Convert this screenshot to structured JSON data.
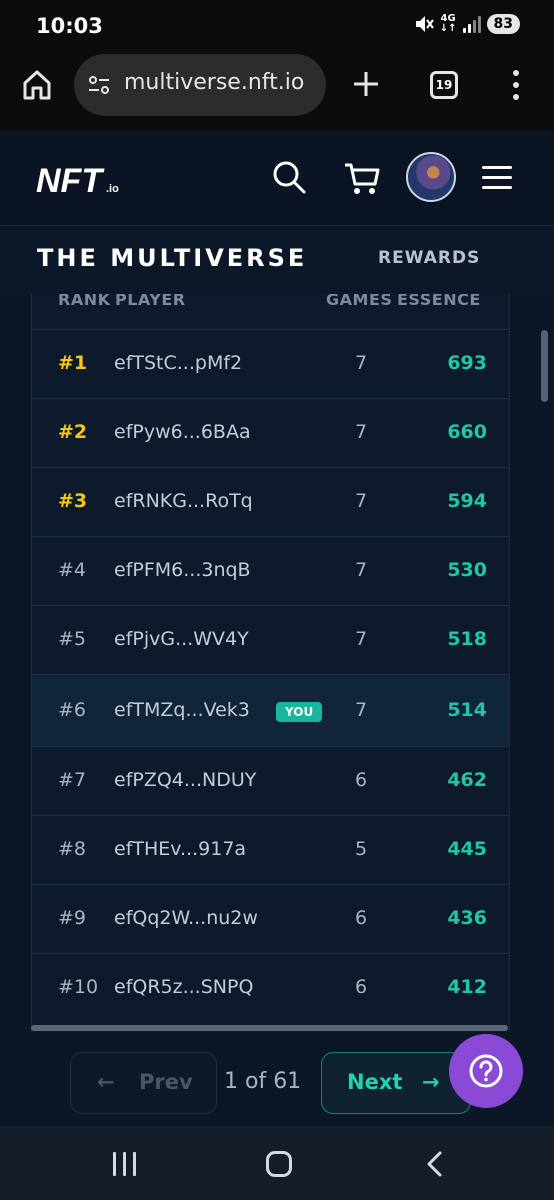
{
  "status_bar": {
    "time": "10:03",
    "network": "4G",
    "battery": "83"
  },
  "browser": {
    "url": "multiverse.nft.io",
    "tab_count": "19"
  },
  "site": {
    "logo_text": "NFT.io",
    "icons": [
      "search-icon",
      "cart-icon",
      "avatar",
      "hamburger-icon"
    ]
  },
  "subnav": {
    "title": "THE MULTIVERSE",
    "rewards": "REWARDS"
  },
  "leaderboard": {
    "headers": {
      "rank": "RANK",
      "player": "PLAYER",
      "games": "GAMES",
      "essence": "ESSENCE"
    },
    "you_badge": "YOU",
    "rows": [
      {
        "rank": "#1",
        "player": "efTStC...pMf2",
        "games": "7",
        "essence": "693"
      },
      {
        "rank": "#2",
        "player": "efPyw6...6BAa",
        "games": "7",
        "essence": "660"
      },
      {
        "rank": "#3",
        "player": "efRNKG...RoTq",
        "games": "7",
        "essence": "594"
      },
      {
        "rank": "#4",
        "player": "efPFM6...3nqB",
        "games": "7",
        "essence": "530"
      },
      {
        "rank": "#5",
        "player": "efPjvG...WV4Y",
        "games": "7",
        "essence": "518"
      },
      {
        "rank": "#6",
        "player": "efTMZq...Vek3",
        "games": "7",
        "essence": "514"
      },
      {
        "rank": "#7",
        "player": "efPZQ4...NDUY",
        "games": "6",
        "essence": "462"
      },
      {
        "rank": "#8",
        "player": "efTHEv...917a",
        "games": "5",
        "essence": "445"
      },
      {
        "rank": "#9",
        "player": "efQq2W...nu2w",
        "games": "6",
        "essence": "436"
      },
      {
        "rank": "#10",
        "player": "efQR5z...SNPQ",
        "games": "6",
        "essence": "412"
      }
    ]
  },
  "pagination": {
    "prev_arrow": "←",
    "prev": "Prev",
    "page_info": "1 of 61",
    "next": "Next",
    "next_arrow": "→"
  },
  "colors": {
    "accent_teal": "#1fc7a6",
    "gold_rank": "#f5c518",
    "help_button": "#8a4ad6",
    "background": "#0b1626"
  }
}
